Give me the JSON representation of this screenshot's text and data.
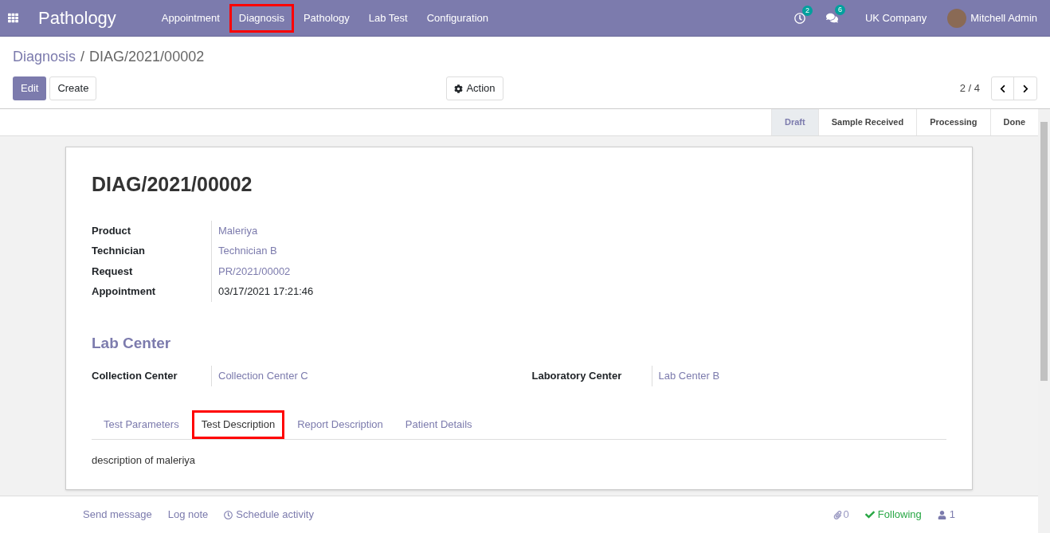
{
  "app_name": "Pathology",
  "menu": [
    {
      "label": "Appointment",
      "highlighted": false
    },
    {
      "label": "Diagnosis",
      "highlighted": true
    },
    {
      "label": "Pathology",
      "highlighted": false
    },
    {
      "label": "Lab Test",
      "highlighted": false
    },
    {
      "label": "Configuration",
      "highlighted": false
    }
  ],
  "systray": {
    "activity_count": "2",
    "message_count": "6",
    "company": "UK Company",
    "user": "Mitchell Admin"
  },
  "breadcrumb": {
    "parent": "Diagnosis",
    "separator": "/",
    "current": "DIAG/2021/00002"
  },
  "buttons": {
    "edit": "Edit",
    "create": "Create",
    "action": "Action"
  },
  "pager": "2 / 4",
  "stages": [
    {
      "label": "Draft",
      "selected": true
    },
    {
      "label": "Sample Received",
      "selected": false
    },
    {
      "label": "Processing",
      "selected": false
    },
    {
      "label": "Done",
      "selected": false
    }
  ],
  "title": "DIAG/2021/00002",
  "fields": [
    {
      "label": "Product",
      "value": "Maleriya",
      "kind": "link"
    },
    {
      "label": "Technician",
      "value": "Technician B",
      "kind": "link"
    },
    {
      "label": "Request",
      "value": "PR/2021/00002",
      "kind": "link"
    },
    {
      "label": "Appointment",
      "value": "03/17/2021 17:21:46",
      "kind": "text"
    }
  ],
  "section_title": "Lab Center",
  "center_fields": [
    {
      "label": "Collection Center",
      "value": "Collection Center C",
      "kind": "link"
    },
    {
      "label": "Laboratory Center",
      "value": "Lab Center B",
      "kind": "link"
    }
  ],
  "tabs": [
    {
      "label": "Test Parameters",
      "selected": false,
      "highlighted": false
    },
    {
      "label": "Test Description",
      "selected": true,
      "highlighted": true
    },
    {
      "label": "Report Description",
      "selected": false,
      "highlighted": false
    },
    {
      "label": "Patient Details",
      "selected": false,
      "highlighted": false
    }
  ],
  "tab_content": "description of maleriya",
  "chatter": {
    "send_message": "Send message",
    "log_note": "Log note",
    "schedule_activity": "Schedule activity",
    "attachments": "0",
    "following": "Following",
    "followers": "1"
  }
}
